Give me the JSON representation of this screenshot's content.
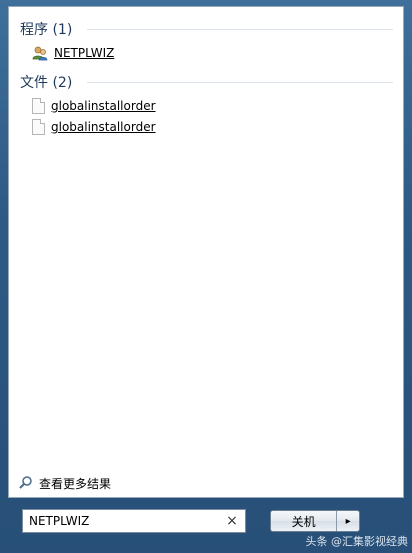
{
  "sections": [
    {
      "title": "程序 (1)",
      "items": [
        {
          "label": "NETPLWIZ",
          "icon": "users-icon"
        }
      ]
    },
    {
      "title": "文件 (2)",
      "items": [
        {
          "label": "globalinstallorder",
          "icon": "document-icon"
        },
        {
          "label": "globalinstallorder",
          "icon": "document-icon"
        }
      ]
    }
  ],
  "more_results": {
    "label": "查看更多结果",
    "icon": "search-icon"
  },
  "search": {
    "value": "NETPLWIZ",
    "clear_glyph": "×"
  },
  "shutdown": {
    "label": "关机",
    "arrow_glyph": "▸"
  },
  "watermark": "头条 @汇集影视经典",
  "colors": {
    "section_title": "#1e395b",
    "frame": "#2d5a85"
  }
}
